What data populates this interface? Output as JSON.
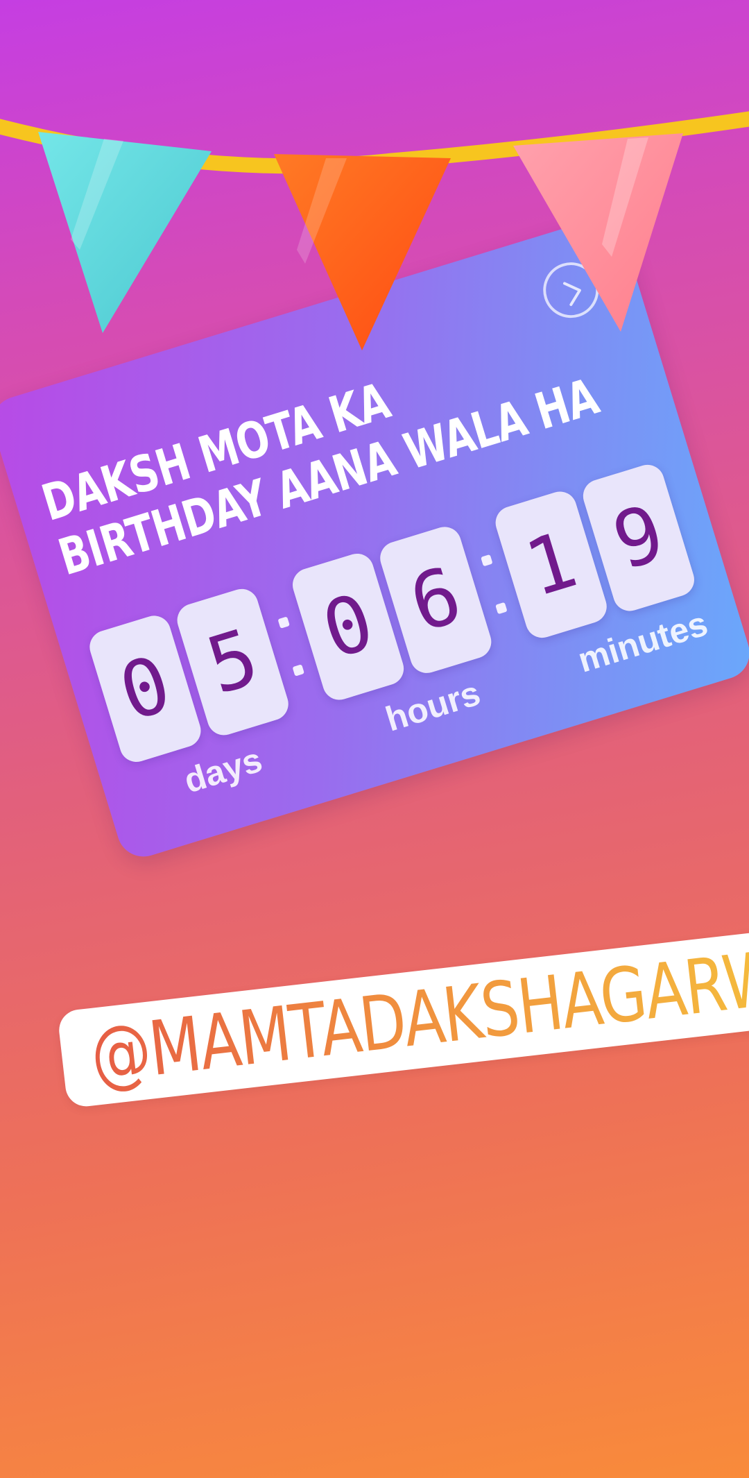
{
  "countdown": {
    "title_line1": "DAKSH MOTA KA",
    "title_line2": "BIRTHDAY AANA WALA HA",
    "days": [
      "0",
      "5"
    ],
    "hours": [
      "0",
      "6"
    ],
    "minutes": [
      "1",
      "9"
    ],
    "label_days": "days",
    "label_hours": "hours",
    "label_minutes": "minutes",
    "arrow_icon": "chevron-right-icon"
  },
  "mention": {
    "text": "@MAMTADAKSHAGARWAL"
  },
  "colors": {
    "flag_teal": "#5fd8dc",
    "flag_orange": "#ff5a1d",
    "flag_pink": "#ff8c99",
    "string_yellow": "#f7c51f",
    "digit_text": "#711a8c"
  },
  "decorations": {
    "bunting": "party-bunting-flags"
  }
}
